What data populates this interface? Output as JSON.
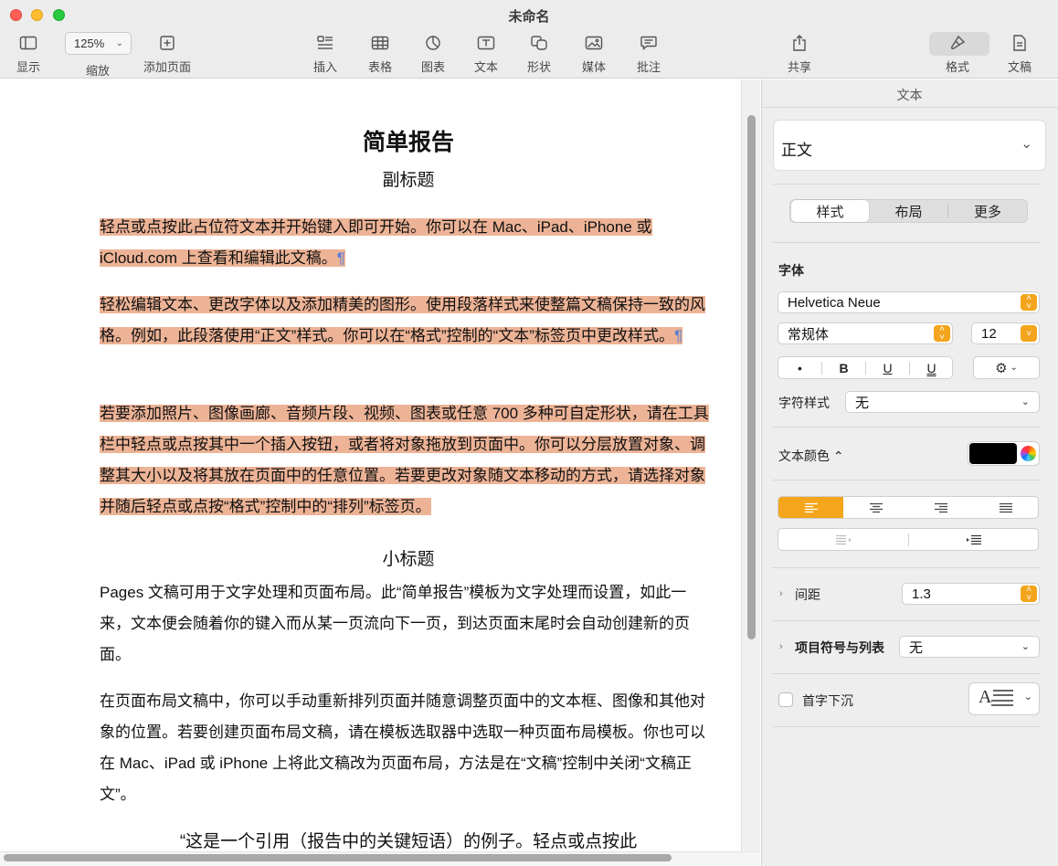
{
  "window": {
    "title": "未命名"
  },
  "toolbar": {
    "view_label": "显示",
    "zoom_value": "125%",
    "zoom_label": "缩放",
    "add_page_label": "添加页面",
    "insert_label": "插入",
    "table_label": "表格",
    "chart_label": "图表",
    "text_label": "文本",
    "shape_label": "形状",
    "media_label": "媒体",
    "comment_label": "批注",
    "share_label": "共享",
    "format_label": "格式",
    "document_label": "文稿"
  },
  "document": {
    "title": "简单报告",
    "subtitle": "副标题",
    "para1": "轻点或点按此占位符文本并开始键入即可开始。你可以在 Mac、iPad、iPhone 或 iCloud.com 上查看和编辑此文稿。",
    "para2": "轻松编辑文本、更改字体以及添加精美的图形。使用段落样式来使整篇文稿保持一致的风格。例如，此段落使用“正文”样式。你可以在“格式”控制的“文本”标签页中更改样式。",
    "para3": "若要添加照片、图像画廊、音频片段、视频、图表或任意 700 多种可自定形状，请在工具栏中轻点或点按其中一个插入按钮，或者将对象拖放到页面中。你可以分层放置对象、调整其大小以及将其放在页面中的任意位置。若要更改对象随文本移动的方式，请选择对象并随后轻点或点按“格式”控制中的“排列”标签页。",
    "heading2": "小标题",
    "para4": "Pages 文稿可用于文字处理和页面布局。此“简单报告”模板为文字处理而设置，如此一来，文本便会随着你的键入而从某一页流向下一页，到达页面末尾时会自动创建新的页面。",
    "para5": "在页面布局文稿中，你可以手动重新排列页面并随意调整页面中的文本框、图像和其他对象的位置。若要创建页面布局文稿，请在模板选取器中选取一种页面布局模板。你也可以在 Mac、iPad 或 iPhone 上将此文稿改为页面布局，方法是在“文稿”控制中关闭“文稿正文”。",
    "quote": "“这是一个引用（报告中的关键短语）的例子。轻点或点按此",
    "pilcrow": "¶"
  },
  "inspector": {
    "header": "文本",
    "paragraph_style": "正文",
    "tabs": [
      "样式",
      "布局",
      "更多"
    ],
    "font_section": "字体",
    "font_family": "Helvetica Neue",
    "font_typeface": "常规体",
    "font_size": "12",
    "format_buttons": [
      "•",
      "B",
      "U",
      "U"
    ],
    "char_style_label": "字符样式",
    "char_style_value": "无",
    "text_color_label": "文本颜色 ⌃",
    "spacing_label": "间距",
    "spacing_value": "1.3",
    "bullets_label": "项目符号与列表",
    "bullets_value": "无",
    "dropcap_label": "首字下沉",
    "dropcap_glyph": "A"
  },
  "colors": {
    "highlight": "#edb396",
    "accent": "#f4a51c",
    "pilcrow": "#5a7fd4"
  }
}
